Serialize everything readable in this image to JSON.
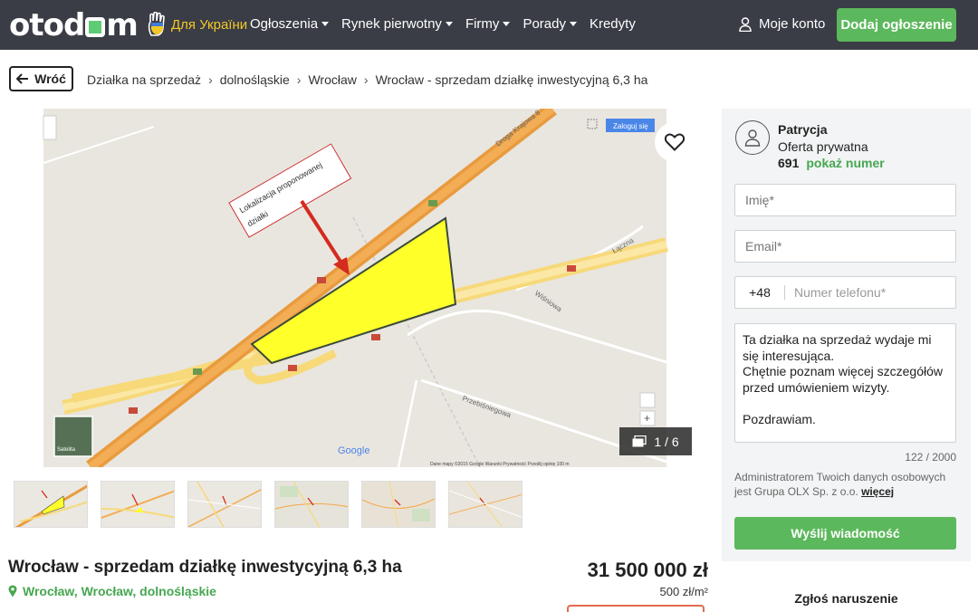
{
  "header": {
    "logo": "otodom",
    "ukraine_label": "Для України",
    "nav": [
      {
        "label": "Ogłoszenia"
      },
      {
        "label": "Rynek pierwotny"
      },
      {
        "label": "Firmy"
      },
      {
        "label": "Porady"
      },
      {
        "label": "Kredyty"
      }
    ],
    "account_label": "Moje konto",
    "add_button": "Dodaj ogłoszenie"
  },
  "breadcrumb": {
    "back_label": "Wróć",
    "items": [
      "Działka na sprzedaż",
      "dolnośląskie",
      "Wrocław",
      "Wrocław - sprzedam działkę inwestycyjną 6,3 ha"
    ]
  },
  "gallery": {
    "counter": "1 / 6",
    "map_annotation_line1": "Lokalizacja proponowanej",
    "map_annotation_line2": "działki",
    "map_login": "Zaloguj się",
    "road_label_1": "Droga Krajowa 8",
    "road_label_2": "Łączna",
    "road_label_3": "Wiśniowa",
    "road_label_4": "Przebiśniegowa",
    "map_logo": "Google",
    "map_footer": "Dane mapy ©2015 Google    Warunki    Prywatność    Prześlij opinię    100 m",
    "satellite_label": "Satelita",
    "thumbnail_count": 6
  },
  "listing": {
    "title": "Wrocław - sprzedam działkę inwestycyjną 6,3 ha",
    "location": "Wrocław, Wrocław, dolnośląskie",
    "price": "31 500 000 zł",
    "price_per_m2": "500 zł/m²"
  },
  "contact": {
    "seller_name": "Patrycja",
    "seller_type": "Oferta prywatna",
    "phone_partial": "691",
    "show_number": "pokaż numer",
    "name_placeholder": "Imię*",
    "email_placeholder": "Email*",
    "phone_prefix": "+48",
    "phone_placeholder": "Numer telefonu*",
    "message": "Ta działka na sprzedaż wydaje mi się interesująca.\nChętnie poznam więcej szczegółów przed umówieniem wizyty.\n\nPozdrawiam.",
    "char_count": "122 / 2000",
    "gdpr_text": "Administratorem Twoich danych osobowych jest Grupa OLX Sp. z o.o.",
    "gdpr_more": "więcej",
    "send_button": "Wyślij wiadomość",
    "report": "Zgłoś naruszenie"
  },
  "colors": {
    "header_bg": "#3a3d45",
    "accent_green": "#5cb85c",
    "link_green": "#46a750",
    "ukraine_yellow": "#f3c728"
  }
}
